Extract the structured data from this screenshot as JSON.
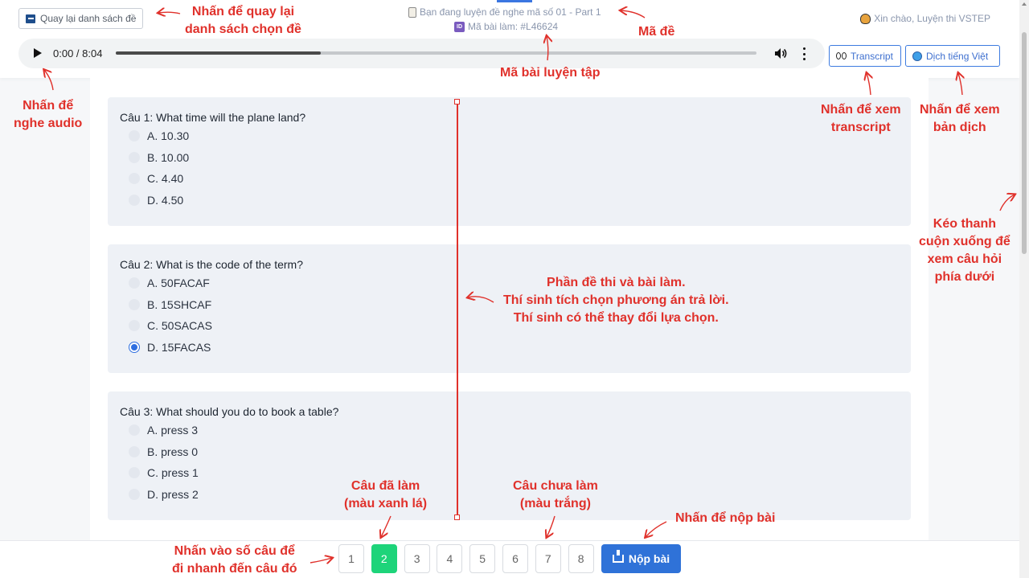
{
  "header": {
    "back_label": "Quay lại danh sách đề",
    "exam_code": "Bạn đang luyện đề nghe mã số 01 - Part 1",
    "attempt_code": "Mã bài làm: #L46624",
    "id_badge": "ID",
    "greeting": "Xin chào, Luyện thi VSTEP"
  },
  "audio": {
    "time": "0:00 / 8:04",
    "progress": 0.32
  },
  "tools": {
    "transcript_label": "Transcript",
    "translate_label": "Dịch tiếng Việt"
  },
  "questions": [
    {
      "title": "Câu 1: What time will the plane land?",
      "options": [
        "A. 10.30",
        "B. 10.00",
        "C. 4.40",
        "D. 4.50"
      ],
      "selected": null
    },
    {
      "title": "Câu 2: What is the code of the term?",
      "options": [
        "A. 50FACAF",
        "B. 15SHCAF",
        "C. 50SACAS",
        "D. 15FACAS"
      ],
      "selected": 3
    },
    {
      "title": "Câu 3: What should you do to book a table?",
      "options": [
        "A. press 3",
        "B. press 0",
        "C. press 1",
        "D. press 2"
      ],
      "selected": null
    }
  ],
  "nav": {
    "numbers": [
      "1",
      "2",
      "3",
      "4",
      "5",
      "6",
      "7",
      "8"
    ],
    "done": [
      "2"
    ],
    "submit_label": "Nộp bài"
  },
  "annotations": {
    "back": [
      "Nhấn để quay lại",
      "danh sách chọn đề"
    ],
    "exam": "Mã đề",
    "attempt": "Mã bài luyện tập",
    "audio": [
      "Nhấn để",
      "nghe audio"
    ],
    "transcript": [
      "Nhấn để xem",
      "transcript"
    ],
    "translate": [
      "Nhấn để xem",
      "bản dịch"
    ],
    "scroll": [
      "Kéo thanh",
      "cuộn xuống để",
      "xem câu hỏi",
      "phía dưới"
    ],
    "content": [
      "Phần đề thi và bài làm.",
      "Thí sinh tích chọn phương án trả lời.",
      "Thí sinh có thể thay đổi lựa chọn."
    ],
    "done": [
      "Câu đã làm",
      "(màu xanh lá)"
    ],
    "undone": [
      "Câu chưa làm",
      "(màu trắng)"
    ],
    "submit": "Nhấn để nộp bài",
    "nav": [
      "Nhấn vào số câu để",
      "đi nhanh đến câu đó"
    ]
  },
  "colors": {
    "annotation": "#e0312b",
    "done": "#1ed47a",
    "primary": "#2f72d8",
    "card": "#eef1f6"
  }
}
